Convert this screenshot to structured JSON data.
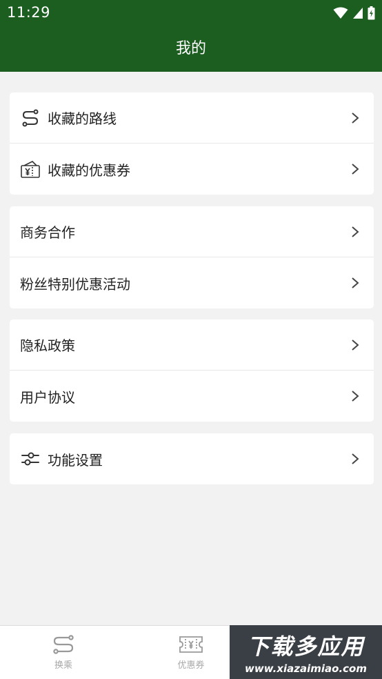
{
  "status_bar": {
    "time": "11:29"
  },
  "header": {
    "title": "我的"
  },
  "groups": [
    {
      "items": [
        {
          "label": "收藏的路线",
          "icon": "route-icon"
        },
        {
          "label": "收藏的优惠券",
          "icon": "coupon-icon"
        }
      ]
    },
    {
      "items": [
        {
          "label": "商务合作"
        },
        {
          "label": "粉丝特别优惠活动"
        }
      ]
    },
    {
      "items": [
        {
          "label": "隐私政策"
        },
        {
          "label": "用户协议"
        }
      ]
    },
    {
      "items": [
        {
          "label": "功能设置",
          "icon": "settings-sliders-icon"
        }
      ]
    }
  ],
  "bottom_nav": {
    "tabs": [
      {
        "label": "换乘",
        "icon": "transfer-icon"
      },
      {
        "label": "优惠券",
        "icon": "coupon-icon"
      }
    ]
  },
  "watermark": {
    "main": "下载多应用",
    "url": "www.xiazaimiao.com"
  },
  "colors": {
    "primary": "#1b5e20",
    "background": "#f2f2f2",
    "text": "#222222",
    "tab_inactive": "#a8a8a8"
  }
}
